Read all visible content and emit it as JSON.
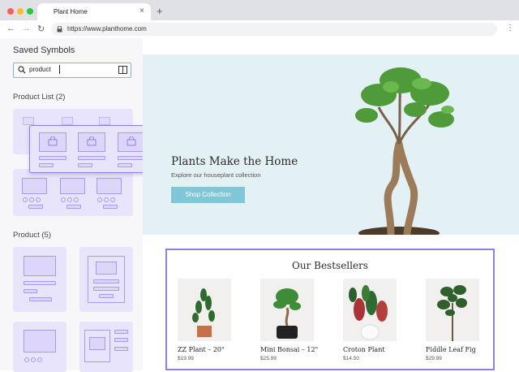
{
  "browser": {
    "tab_title": "Plant Home",
    "tab_close": "×",
    "new_tab": "+",
    "url": "https://www.planthome.com",
    "colors": {
      "close": "#ff5f57",
      "minimize": "#febc2e",
      "maximize": "#28c840"
    }
  },
  "sidebar": {
    "title": "Saved Symbols",
    "search_value": "product",
    "sections": [
      {
        "label": "Product List (2)"
      },
      {
        "label": "Product (5)"
      }
    ]
  },
  "hero": {
    "title": "Plants Make the Home",
    "subtitle": "Explore our houseplant collection",
    "button": "Shop Collection"
  },
  "bestsellers": {
    "title": "Our Bestsellers",
    "products": [
      {
        "name": "ZZ Plant – 20\"",
        "price": "$19.99"
      },
      {
        "name": "Mini Bonsai – 12\"",
        "price": "$25.99"
      },
      {
        "name": "Croton Plant",
        "price": "$14.50"
      },
      {
        "name": "Fiddle Leaf Fig",
        "price": "$29.99"
      }
    ]
  },
  "icons": [
    "back-arrow-icon",
    "forward-arrow-icon",
    "reload-icon",
    "lock-icon",
    "menu-icon",
    "search-icon",
    "book-icon",
    "cursor-icon",
    "bag-icon"
  ]
}
